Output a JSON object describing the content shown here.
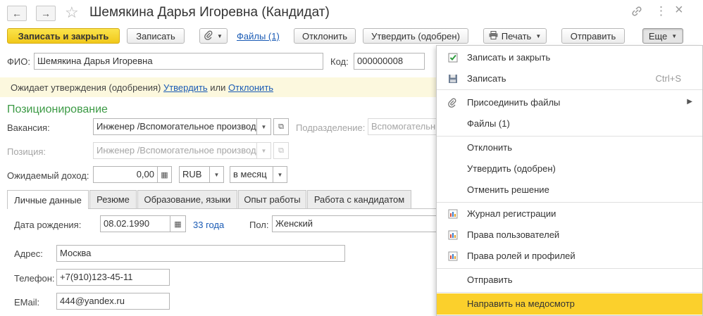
{
  "window": {
    "title": "Шемякина Дарья Игоревна (Кандидат)",
    "back_icon": "←",
    "forward_icon": "→",
    "star_icon": "☆",
    "link_icon": "🔗",
    "more_icon": "⋮",
    "close_icon": "×"
  },
  "toolbar": {
    "save_close": "Записать и закрыть",
    "save": "Записать",
    "attach_icon": "📎",
    "files_link": "Файлы (1)",
    "reject": "Отклонить",
    "approve": "Утвердить (одобрен)",
    "print": "Печать",
    "print_icon": "🖨",
    "send": "Отправить",
    "more": "Еще",
    "caret": "▼"
  },
  "form": {
    "fio_label": "ФИО:",
    "fio_value": "Шемякина Дарья Игоревна",
    "code_label": "Код:",
    "code_value": "000000008",
    "banner_prefix": "Ожидает утверждения (одобрения) ",
    "banner_approve": "Утвердить",
    "banner_or": " или ",
    "banner_reject": "Отклонить",
    "section_title": "Позиционирование",
    "vacancy_label": "Вакансия:",
    "vacancy_value": "Инженер /Вспомогательное производ",
    "division_label": "Подразделение:",
    "division_value": "Вспомогательн",
    "position_label": "Позиция:",
    "position_value": "Инженер /Вспомогательное производ",
    "income_label": "Ожидаемый доход:",
    "income_value": "0,00",
    "currency_value": "RUB",
    "period_value": "в месяц",
    "calc_icon": "▦",
    "open_icon": "⧉"
  },
  "tabs": [
    "Личные данные",
    "Резюме",
    "Образование, языки",
    "Опыт работы",
    "Работа с кандидатом"
  ],
  "personal": {
    "birth_label": "Дата рождения:",
    "birth_value": "08.02.1990",
    "calendar_icon": "▦",
    "age_link": "33 года",
    "sex_label": "Пол:",
    "sex_value": "Женский",
    "address_label": "Адрес:",
    "address_value": "Москва",
    "phone_label": "Телефон:",
    "phone_value": "+7(910)123-45-11",
    "email_label": "EMail:",
    "email_value": "444@yandex.ru"
  },
  "menu": {
    "items": [
      {
        "label": "Записать и закрыть",
        "shortcut": "",
        "icon": "check-icon"
      },
      {
        "label": "Записать",
        "shortcut": "Ctrl+S",
        "icon": "save-icon"
      },
      {
        "label": "Присоединить файлы",
        "shortcut": "",
        "icon": "paperclip-icon"
      },
      {
        "label": "Файлы (1)",
        "shortcut": "",
        "icon": ""
      },
      {
        "label": "Отклонить",
        "shortcut": "",
        "icon": ""
      },
      {
        "label": "Утвердить (одобрен)",
        "shortcut": "",
        "icon": ""
      },
      {
        "label": "Отменить решение",
        "shortcut": "",
        "icon": ""
      },
      {
        "label": "Журнал регистрации",
        "shortcut": "",
        "icon": "report-icon"
      },
      {
        "label": "Права пользователей",
        "shortcut": "",
        "icon": "report-icon"
      },
      {
        "label": "Права ролей и профилей",
        "shortcut": "",
        "icon": "report-icon"
      },
      {
        "label": "Отправить",
        "shortcut": "",
        "icon": ""
      },
      {
        "label": "Направить на медосмотр",
        "shortcut": "",
        "icon": ""
      }
    ],
    "submenu_arrow": "▶",
    "highlight_color": "#fbd02c"
  }
}
